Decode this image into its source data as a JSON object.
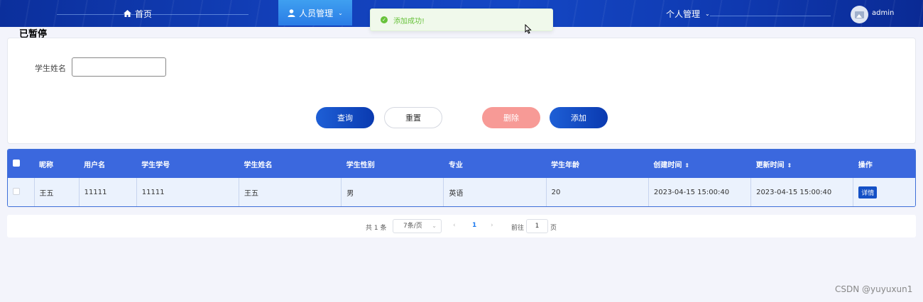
{
  "topnav": {
    "home_label": "首页",
    "people_label": "人员管理",
    "personal_label": "个人管理",
    "user_name": "admin"
  },
  "toast": {
    "message": "添加成功!"
  },
  "page_label": "已暂停",
  "search": {
    "field_label": "学生姓名",
    "field_value": "",
    "query_label": "查询",
    "reset_label": "重置",
    "delete_label": "删除",
    "add_label": "添加"
  },
  "table": {
    "headers": [
      "昵称",
      "用户名",
      "学生学号",
      "学生姓名",
      "学生性别",
      "专业",
      "学生年龄",
      "创建时间",
      "更新时间",
      "操作"
    ],
    "rows": [
      [
        "王五",
        "11111",
        "11111",
        "王五",
        "男",
        "英语",
        "20",
        "2023-04-15 15:00:40",
        "2023-04-15 15:00:40",
        "详情"
      ]
    ]
  },
  "pagination": {
    "total_label": "共 1 条",
    "page_size_label": "7条/页",
    "current_page": "1",
    "goto_label": "前往",
    "goto_value": "1",
    "page_suffix": "页"
  },
  "watermark": "CSDN @yuyuxun1",
  "colors": {
    "nav_bg": "#1447c4",
    "primary": "#1450c6",
    "danger": "#f79a96",
    "success": "#67c23a",
    "table_header": "#3b68de"
  }
}
